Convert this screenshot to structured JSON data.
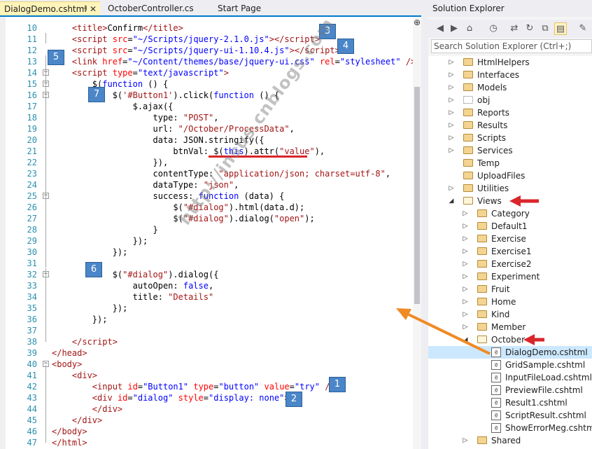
{
  "tabs": [
    {
      "label": "DialogDemo.cshtml",
      "active": true
    },
    {
      "label": "OctoberController.cs",
      "active": false
    },
    {
      "label": "Start Page",
      "active": false
    }
  ],
  "tab_pin_icon": "pin-icon",
  "tab_close_icon": "close-icon",
  "editor": {
    "lines": [
      {
        "n": "10",
        "html": "    <span class='tag'>&lt;title&gt;</span>Confirm<span class='tag'>&lt;/title&gt;</span>"
      },
      {
        "n": "11",
        "html": "    <span class='tag'>&lt;script</span> <span class='at'>src</span>=<span class='av'>\"~/Scripts/jquery-2.1.0.js\"</span><span class='tag'>&gt;&lt;/script&gt;</span>"
      },
      {
        "n": "12",
        "html": "    <span class='tag'>&lt;script</span> <span class='at'>src</span>=<span class='av'>\"~/Scripts/jquery-ui-1.10.4.js\"</span><span class='tag'>&gt;&lt;/script&gt;</span>"
      },
      {
        "n": "13",
        "html": "    <span class='tag'>&lt;link</span> <span class='at'>href</span>=<span class='av'>\"~/Content/themes/base/jquery-ui.css\"</span> <span class='at'>rel</span>=<span class='av'>\"stylesheet\"</span> <span class='tag'>/&gt;</span>"
      },
      {
        "n": "14",
        "html": "    <span class='tag'>&lt;script</span> <span class='at'>type</span>=<span class='av'>\"text/javascript\"</span><span class='tag'>&gt;</span>"
      },
      {
        "n": "15",
        "html": "        $(<span class='k'>function</span> () {"
      },
      {
        "n": "16",
        "html": "            $(<span class='s'>'#Button1'</span>).click(<span class='k'>function</span> () {"
      },
      {
        "n": "17",
        "html": "                $.ajax({"
      },
      {
        "n": "18",
        "html": "                    type: <span class='s'>\"POST\"</span>,"
      },
      {
        "n": "19",
        "html": "                    url: <span class='s'>\"/October/ProcessData\"</span>,"
      },
      {
        "n": "20",
        "html": "                    data: JSON.stringify({"
      },
      {
        "n": "21",
        "html": "                        btnVal: $(<span class='k'>this</span>).attr(<span class='s'>\"value\"</span>),"
      },
      {
        "n": "22",
        "html": "                    }),"
      },
      {
        "n": "23",
        "html": "                    contentType: <span class='s'>\"application/json; charset=utf-8\"</span>,"
      },
      {
        "n": "24",
        "html": "                    dataType: <span class='s'>\"json\"</span>,"
      },
      {
        "n": "25",
        "html": "                    success: <span class='k'>function</span> (data) {"
      },
      {
        "n": "26",
        "html": "                        $(<span class='s'>\"#dialog\"</span>).html(data.d);"
      },
      {
        "n": "27",
        "html": "                        $(<span class='s'>\"#dialog\"</span>).dialog(<span class='s'>\"open\"</span>);"
      },
      {
        "n": "28",
        "html": "                    }"
      },
      {
        "n": "29",
        "html": "                });"
      },
      {
        "n": "30",
        "html": "            });"
      },
      {
        "n": "31",
        "html": ""
      },
      {
        "n": "32",
        "html": "            $(<span class='s'>\"#dialog\"</span>).dialog({"
      },
      {
        "n": "33",
        "html": "                autoOpen: <span class='k'>false</span>,"
      },
      {
        "n": "34",
        "html": "                title: <span class='s'>\"Details\"</span>"
      },
      {
        "n": "35",
        "html": "            });"
      },
      {
        "n": "36",
        "html": "        });"
      },
      {
        "n": "37",
        "html": ""
      },
      {
        "n": "38",
        "html": "    <span class='tag'>&lt;/script&gt;</span>"
      },
      {
        "n": "39",
        "html": "<span class='tag'>&lt;/head&gt;</span>"
      },
      {
        "n": "40",
        "html": "<span class='tag'>&lt;body&gt;</span>"
      },
      {
        "n": "41",
        "html": "    <span class='tag'>&lt;div&gt;</span>"
      },
      {
        "n": "42",
        "html": "        <span class='tag'>&lt;input</span> <span class='at'>id</span>=<span class='av'>\"Button1\"</span> <span class='at'>type</span>=<span class='av'>\"button\"</span> <span class='at'>value</span>=<span class='av'>\"try\"</span> <span class='tag'>/&gt;</span>"
      },
      {
        "n": "43",
        "html": "        <span class='tag'>&lt;div</span> <span class='at'>id</span>=<span class='av'>\"dialog\"</span> <span class='at'>style</span>=<span class='av'>\"display: none\"</span><span class='tag'>&gt;</span>"
      },
      {
        "n": "44",
        "html": "        <span class='tag'>&lt;/div&gt;</span>"
      },
      {
        "n": "45",
        "html": "    <span class='tag'>&lt;/div&gt;</span>"
      },
      {
        "n": "46",
        "html": "<span class='tag'>&lt;/body&gt;</span>"
      },
      {
        "n": "47",
        "html": "<span class='tag'>&lt;/html&gt;</span>"
      }
    ],
    "fold_lines": [
      "14",
      "15",
      "16",
      "25",
      "32",
      "40"
    ],
    "badges": [
      "1",
      "2",
      "3",
      "4",
      "5",
      "6",
      "7"
    ],
    "watermark": "http://insus.cnblogs.com",
    "split_icon": "split-icon"
  },
  "solution_explorer": {
    "title": "Solution Explorer",
    "toolbar_icons": [
      "back-icon",
      "forward-icon",
      "home-icon",
      "history-icon",
      "sync-icon",
      "refresh-icon",
      "collapse-icon",
      "show-all-icon",
      "properties-icon"
    ],
    "search_placeholder": "Search Solution Explorer (Ctrl+;)",
    "items": [
      {
        "label": "HtmlHelpers",
        "level": 0,
        "type": "folder",
        "expanded": false
      },
      {
        "label": "Interfaces",
        "level": 0,
        "type": "folder",
        "expanded": false
      },
      {
        "label": "Models",
        "level": 0,
        "type": "folder",
        "expanded": false
      },
      {
        "label": "obj",
        "level": 0,
        "type": "folder-hidden",
        "expanded": false
      },
      {
        "label": "Reports",
        "level": 0,
        "type": "folder",
        "expanded": false
      },
      {
        "label": "Results",
        "level": 0,
        "type": "folder",
        "expanded": false
      },
      {
        "label": "Scripts",
        "level": 0,
        "type": "folder",
        "expanded": false
      },
      {
        "label": "Services",
        "level": 0,
        "type": "folder",
        "expanded": false
      },
      {
        "label": "Temp",
        "level": 0,
        "type": "folder",
        "expanded": null
      },
      {
        "label": "UploadFiles",
        "level": 0,
        "type": "folder",
        "expanded": null
      },
      {
        "label": "Utilities",
        "level": 0,
        "type": "folder",
        "expanded": false
      },
      {
        "label": "Views",
        "level": 0,
        "type": "folder",
        "expanded": true
      },
      {
        "label": "Category",
        "level": 1,
        "type": "folder",
        "expanded": false
      },
      {
        "label": "Default1",
        "level": 1,
        "type": "folder",
        "expanded": false
      },
      {
        "label": "Exercise",
        "level": 1,
        "type": "folder",
        "expanded": false
      },
      {
        "label": "Exercise1",
        "level": 1,
        "type": "folder",
        "expanded": false
      },
      {
        "label": "Exercise2",
        "level": 1,
        "type": "folder",
        "expanded": false
      },
      {
        "label": "Experiment",
        "level": 1,
        "type": "folder",
        "expanded": false
      },
      {
        "label": "Fruit",
        "level": 1,
        "type": "folder",
        "expanded": false
      },
      {
        "label": "Home",
        "level": 1,
        "type": "folder",
        "expanded": false
      },
      {
        "label": "Kind",
        "level": 1,
        "type": "folder",
        "expanded": false
      },
      {
        "label": "Member",
        "level": 1,
        "type": "folder",
        "expanded": false
      },
      {
        "label": "October",
        "level": 1,
        "type": "folder",
        "expanded": true
      },
      {
        "label": "DialogDemo.cshtml",
        "level": 2,
        "type": "file",
        "selected": true
      },
      {
        "label": "GridSample.cshtml",
        "level": 2,
        "type": "file"
      },
      {
        "label": "InputFileLoad.cshtml",
        "level": 2,
        "type": "file"
      },
      {
        "label": "PreviewFile.cshtml",
        "level": 2,
        "type": "file"
      },
      {
        "label": "Result1.cshtml",
        "level": 2,
        "type": "file"
      },
      {
        "label": "ScriptResult.cshtml",
        "level": 2,
        "type": "file"
      },
      {
        "label": "ShowErrorMeg.cshtml",
        "level": 2,
        "type": "file"
      },
      {
        "label": "Shared",
        "level": 1,
        "type": "folder",
        "expanded": false
      }
    ]
  },
  "colors": {
    "accent": "#007acc",
    "badge": "#4a86c8",
    "annotation_red": "#d9262b",
    "annotation_orange": "#f08a24",
    "selection": "#cce8ff"
  }
}
